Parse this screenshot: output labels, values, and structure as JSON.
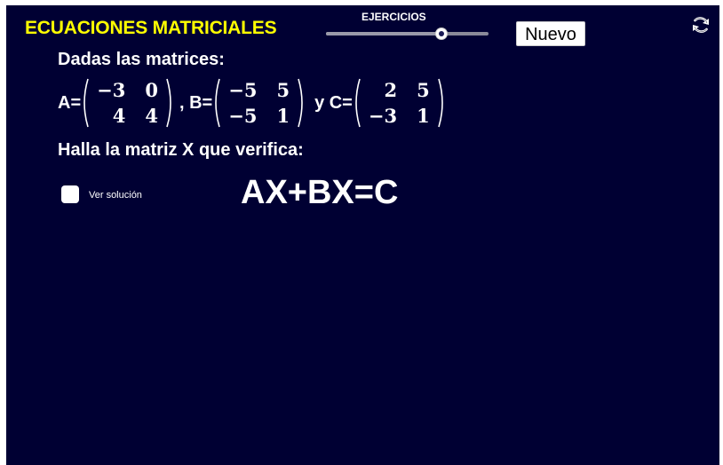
{
  "header": {
    "title": "ECUACIONES MATRICIALES",
    "title_color": "#ffff00",
    "background_color": "#000033"
  },
  "slider": {
    "label": "EJERCICIOS",
    "value_fraction": 0.71
  },
  "buttons": {
    "nuevo_label": "Nuevo",
    "refresh_icon": "refresh-icon"
  },
  "problem": {
    "intro": "Dadas las matrices:",
    "labels": {
      "a": "A=",
      "b": ", B=",
      "c": "y C="
    },
    "matrix_a": [
      [
        "−3",
        "0"
      ],
      [
        "4",
        "4"
      ]
    ],
    "matrix_b": [
      [
        "−5",
        "5"
      ],
      [
        "−5",
        "1"
      ]
    ],
    "matrix_c": [
      [
        "2",
        "5"
      ],
      [
        "−3",
        "1"
      ]
    ],
    "question": "Halla la matriz X que verifica:",
    "equation": "AX+BX=C"
  },
  "solution_toggle": {
    "label": "Ver solución",
    "checked": false
  }
}
